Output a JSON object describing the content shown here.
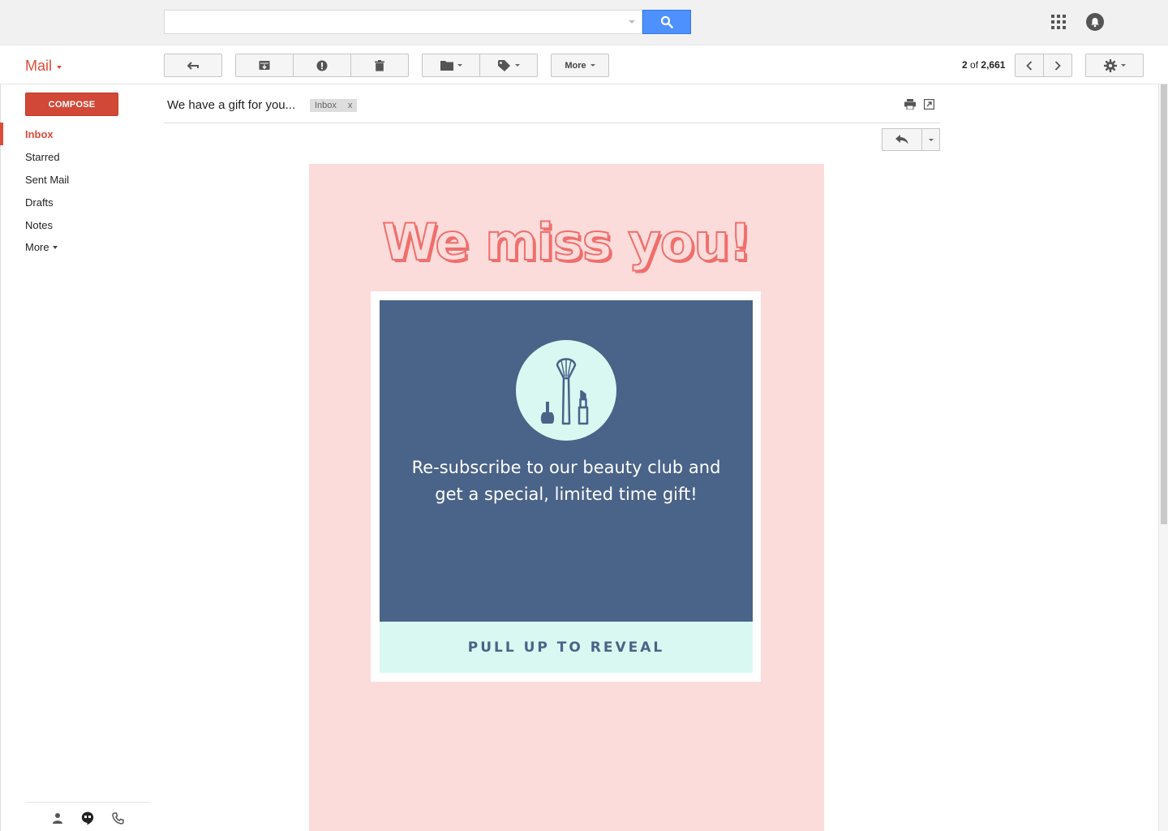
{
  "search": {
    "placeholder": "",
    "value": ""
  },
  "header": {
    "app_label": "Mail"
  },
  "toolbar": {
    "more_label": "More",
    "pager": {
      "current": "2",
      "of_label": "of",
      "total": "2,661"
    }
  },
  "sidebar": {
    "compose_label": "COMPOSE",
    "items": [
      {
        "label": "Inbox",
        "active": true
      },
      {
        "label": "Starred"
      },
      {
        "label": "Sent Mail"
      },
      {
        "label": "Drafts"
      },
      {
        "label": "Notes"
      },
      {
        "label": "More"
      }
    ]
  },
  "message": {
    "subject": "We have a gift for you...",
    "label_chip": "Inbox",
    "label_remove": "x"
  },
  "email": {
    "headline": "We miss you!",
    "body_line1": "Re-subscribe to our beauty club and",
    "body_line2": "get a special, limited time gift!",
    "cta": "PULL UP TO REVEAL"
  },
  "colors": {
    "brand_red": "#dd4b39",
    "search_blue": "#4d90fe",
    "email_pink": "#fbdcdb",
    "headline_coral": "#ef6f6c",
    "card_blue": "#4a6388",
    "mint": "#d9f8f1"
  },
  "icons": {
    "search": "search-icon",
    "apps": "apps-grid-icon",
    "notifications": "notifications-icon",
    "back": "back-arrow-icon",
    "archive": "archive-icon",
    "spam": "report-spam-icon",
    "delete": "trash-icon",
    "move": "folder-icon",
    "labels": "label-tag-icon",
    "prev": "chevron-left-icon",
    "next": "chevron-right-icon",
    "settings": "gear-icon",
    "print": "print-icon",
    "popout": "new-window-icon",
    "reply": "reply-icon",
    "more_actions": "caret-down-icon",
    "contacts": "person-icon",
    "hangouts": "hangouts-icon",
    "phone": "phone-icon",
    "beauty": "makeup-brush-icon"
  }
}
